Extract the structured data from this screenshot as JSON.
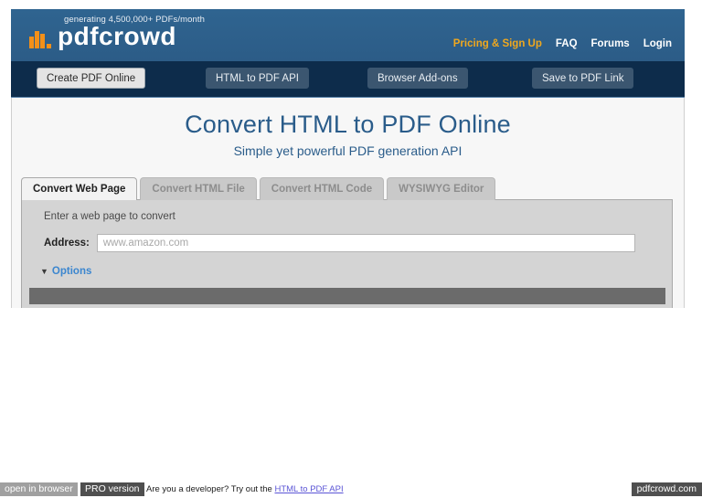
{
  "header": {
    "tagline": "generating 4,500,000+ PDFs/month",
    "logo_text": "pdfcrowd",
    "logo_icon": "bar-chart-icon",
    "nav": [
      {
        "label": "Pricing & Sign Up",
        "accent": true
      },
      {
        "label": "FAQ",
        "accent": false
      },
      {
        "label": "Forums",
        "accent": false
      },
      {
        "label": "Login",
        "accent": false
      }
    ],
    "accent_color": "#f0a81e",
    "bar_color": "#2c5d89"
  },
  "subnav": {
    "background": "#0d2c4b",
    "buttons": [
      {
        "label": "Create PDF Online",
        "active": true
      },
      {
        "label": "HTML to PDF API",
        "active": false
      },
      {
        "label": "Browser Add-ons",
        "active": false
      },
      {
        "label": "Save to PDF Link",
        "active": false
      }
    ]
  },
  "main": {
    "title": "Convert HTML to PDF Online",
    "subtitle": "Simple yet powerful PDF generation API",
    "title_color": "#2a5c8a",
    "tabs": [
      {
        "label": "Convert Web Page",
        "active": true
      },
      {
        "label": "Convert HTML File",
        "active": false
      },
      {
        "label": "Convert HTML Code",
        "active": false
      },
      {
        "label": "WYSIWYG Editor",
        "active": false
      }
    ],
    "form": {
      "hint": "Enter a web page to convert",
      "address_label": "Address:",
      "address_value": "",
      "address_placeholder": "www.amazon.com",
      "options_caret": "▼",
      "options_label": "Options",
      "options_color": "#3b86cf"
    }
  },
  "footer": {
    "open_in_browser": "open in browser",
    "pro_version": "PRO version",
    "note_text": "Are you a developer? Try out the ",
    "note_link": "HTML to PDF API",
    "site_badge": "pdfcrowd.com"
  }
}
